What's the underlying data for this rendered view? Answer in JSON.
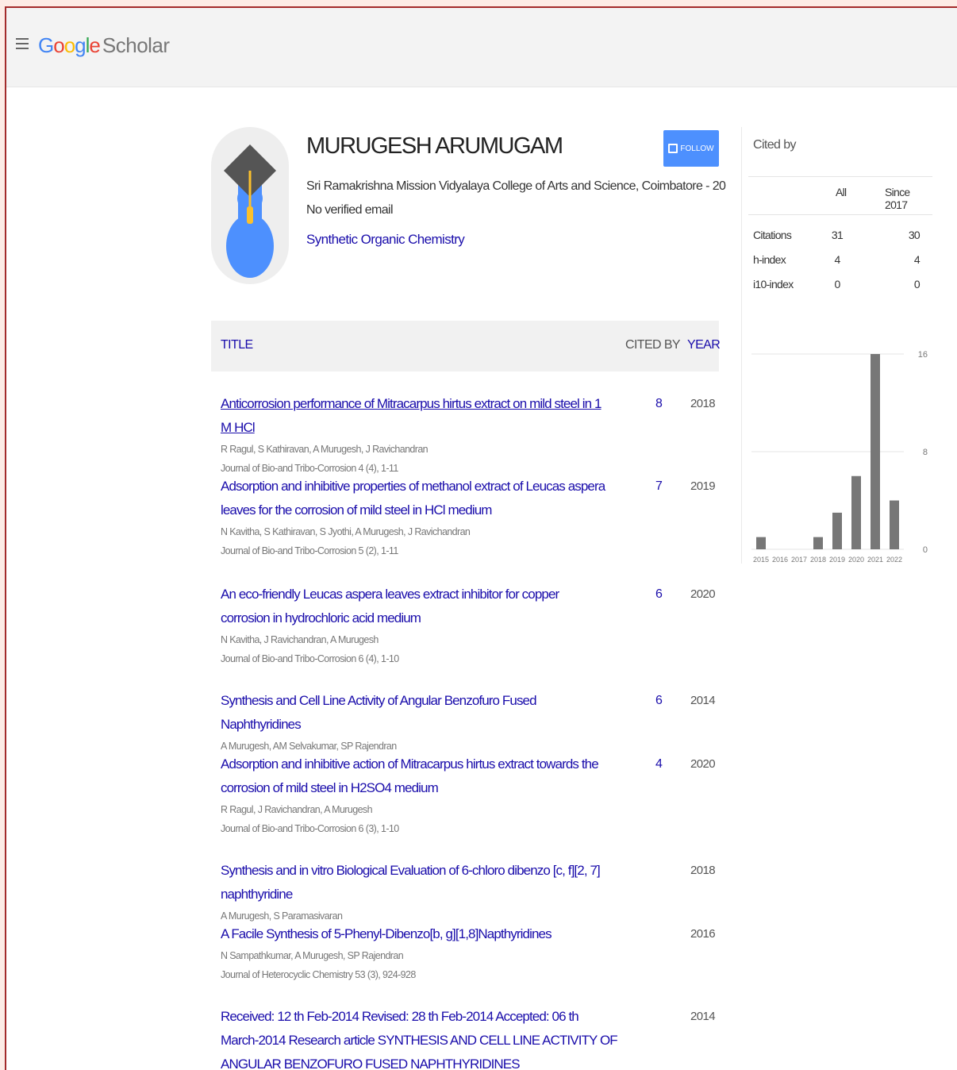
{
  "header": {
    "logo_letters": [
      "G",
      "o",
      "o",
      "g",
      "l",
      "e"
    ],
    "logo_product": "Scholar"
  },
  "profile": {
    "name": "MURUGESH ARUMUGAM",
    "affiliation": "Sri Ramakrishna Mission Vidyalaya College of Arts and Science, Coimbatore - 20",
    "email_status": "No verified email",
    "interest": "Synthetic Organic Chemistry",
    "follow_label": "FOLLOW"
  },
  "table": {
    "col_title": "TITLE",
    "col_cited": "CITED BY",
    "col_year": "YEAR",
    "rows": [
      {
        "title": "Anticorrosion performance of Mitracarpus hirtus extract on mild steel in 1 M HCl",
        "authors": "R Ragul, S Kathiravan, A Murugesh, J Ravichandran",
        "journal": "Journal of Bio-and Tribo-Corrosion 4 (4), 1-11",
        "cited": "8",
        "year": "2018"
      },
      {
        "title": "Adsorption and inhibitive properties of methanol extract of Leucas aspera leaves for the corrosion of mild steel in HCl medium",
        "authors": "N Kavitha, S Kathiravan, S Jyothi, A Murugesh, J Ravichandran",
        "journal": "Journal of Bio-and Tribo-Corrosion 5 (2), 1-11",
        "cited": "7",
        "year": "2019"
      },
      {
        "title": "An eco-friendly Leucas aspera leaves extract inhibitor for copper corrosion in hydrochloric acid medium",
        "authors": "N Kavitha, J Ravichandran, A Murugesh",
        "journal": "Journal of Bio-and Tribo-Corrosion 6 (4), 1-10",
        "cited": "6",
        "year": "2020"
      },
      {
        "title": "Synthesis and Cell Line Activity of Angular Benzofuro Fused Naphthyridines",
        "authors": "A Murugesh, AM Selvakumar, SP Rajendran",
        "journal": "",
        "cited": "6",
        "year": "2014"
      },
      {
        "title": "Adsorption and inhibitive action of Mitracarpus hirtus extract towards the corrosion of mild steel in H2SO4 medium",
        "authors": "R Ragul, J Ravichandran, A Murugesh",
        "journal": "Journal of Bio-and Tribo-Corrosion 6 (3), 1-10",
        "cited": "4",
        "year": "2020"
      },
      {
        "title": "Synthesis and in vitro Biological Evaluation of 6-chloro dibenzo [c, f][2, 7] naphthyridine",
        "authors": "A Murugesh, S Paramasivaran",
        "journal": "",
        "cited": "",
        "year": "2018"
      },
      {
        "title": "A Facile Synthesis of 5-Phenyl-Dibenzo[b, g][1,8]Napthyridines",
        "authors": "N Sampathkumar, A Murugesh, SP Rajendran",
        "journal": "Journal of Heterocyclic Chemistry 53 (3), 924-928",
        "cited": "",
        "year": "2016"
      },
      {
        "title": "Received: 12 th Feb-2014 Revised: 28 th Feb-2014 Accepted: 06 th March-2014 Research article SYNTHESIS AND CELL LINE ACTIVITY OF ANGULAR BENZOFURO FUSED NAPHTHYRIDINES",
        "authors": "",
        "journal": "",
        "cited": "",
        "year": "2014"
      }
    ]
  },
  "cited_by": {
    "title": "Cited by",
    "col_all": "All",
    "col_since": "Since 2017",
    "stats": [
      {
        "label": "Citations",
        "all": "31",
        "since": "30"
      },
      {
        "label": "h-index",
        "all": "4",
        "since": "4"
      },
      {
        "label": "i10-index",
        "all": "0",
        "since": "0"
      }
    ]
  },
  "chart_data": {
    "type": "bar",
    "categories": [
      "2015",
      "2016",
      "2017",
      "2018",
      "2019",
      "2020",
      "2021",
      "2022"
    ],
    "values": [
      1,
      0,
      1,
      3,
      6,
      16,
      4
    ],
    "year_values": {
      "2015": 1,
      "2016": 0,
      "2017": 0,
      "2018": 1,
      "2019": 3,
      "2020": 6,
      "2021": 16,
      "2022": 4
    },
    "yticks": [
      0,
      8,
      16
    ],
    "ylim": [
      0,
      16
    ],
    "bar_color": "#777777",
    "grid": true
  },
  "colors": {
    "link": "#1a0dab",
    "follow_button": "#4d90fe",
    "frame_border": "#a32b2b"
  }
}
